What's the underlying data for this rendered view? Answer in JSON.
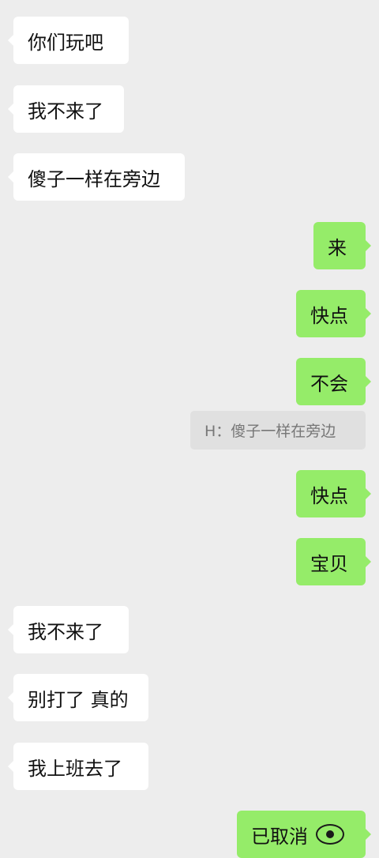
{
  "chat": {
    "messages": [
      {
        "side": "in",
        "text": "你们玩吧"
      },
      {
        "side": "in",
        "text": "我不来了"
      },
      {
        "side": "in",
        "text": "傻子一样在旁边"
      },
      {
        "side": "out",
        "text": "来"
      },
      {
        "side": "out",
        "text": "快点"
      },
      {
        "side": "out",
        "text": "不会"
      },
      {
        "side": "out",
        "text": "快点"
      },
      {
        "side": "out",
        "text": "宝贝"
      },
      {
        "side": "in",
        "text": "我不来了"
      },
      {
        "side": "in",
        "text": "别打了 真的"
      },
      {
        "side": "in",
        "text": "我上班去了"
      },
      {
        "side": "out",
        "text": "已取消"
      }
    ],
    "quote": {
      "text": "H：傻子一样在旁边"
    }
  },
  "colors": {
    "background": "#ededed",
    "incoming_bubble": "#ffffff",
    "outgoing_bubble": "#95ec69",
    "quote_bubble": "#e0e0e0"
  },
  "icons": {
    "last_message_icon": "eye-icon"
  }
}
